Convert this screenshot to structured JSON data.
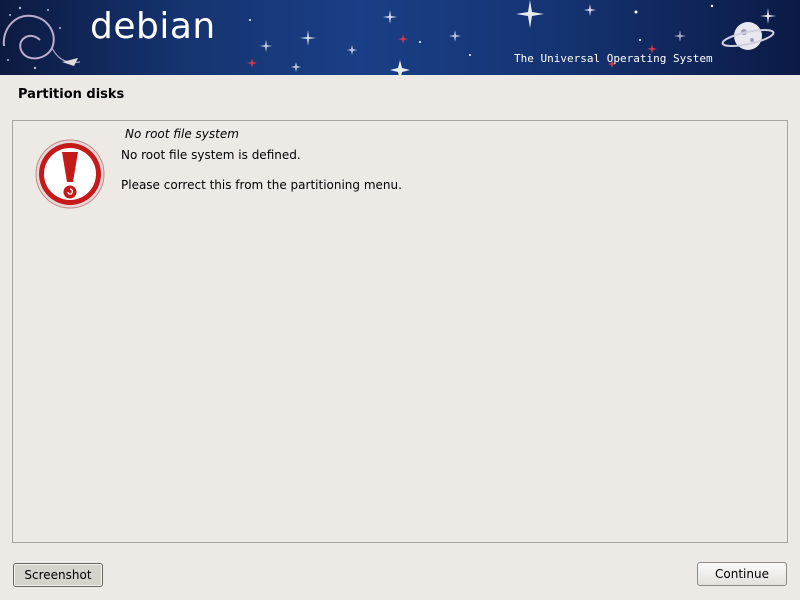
{
  "banner": {
    "logo_text": "debian",
    "tagline": "The Universal Operating System"
  },
  "page": {
    "title": "Partition disks"
  },
  "dialog": {
    "icon": "warning-icon",
    "heading": "No root file system",
    "line1": "No root file system is defined.",
    "line2": "Please correct this from the partitioning menu."
  },
  "buttons": {
    "screenshot": "Screenshot",
    "continue": "Continue"
  },
  "colors": {
    "banner_dark": "#0c1a40",
    "banner_mid": "#1a3f86",
    "warning_red": "#c41a1a",
    "background": "#edeae5"
  }
}
